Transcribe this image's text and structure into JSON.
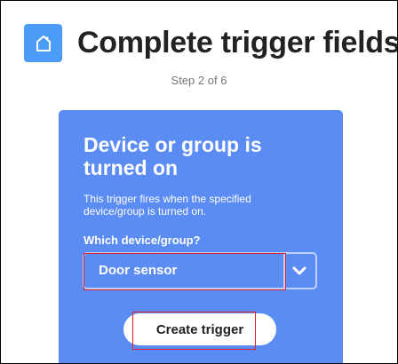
{
  "header": {
    "app_icon": "home-icon",
    "title": "Complete trigger fields",
    "step": "Step 2 of 6"
  },
  "card": {
    "title": "Device or group is turned on",
    "description": "This trigger fires when the specified device/group is turned on.",
    "field_label": "Which device/group?",
    "select": {
      "selected_value": "Door sensor",
      "icon": "chevron-down-icon"
    },
    "button_label": "Create trigger"
  },
  "colors": {
    "card_background": "#5b8cf4",
    "app_icon_background": "#4a9cf7",
    "highlight_border": "#e0202b"
  }
}
